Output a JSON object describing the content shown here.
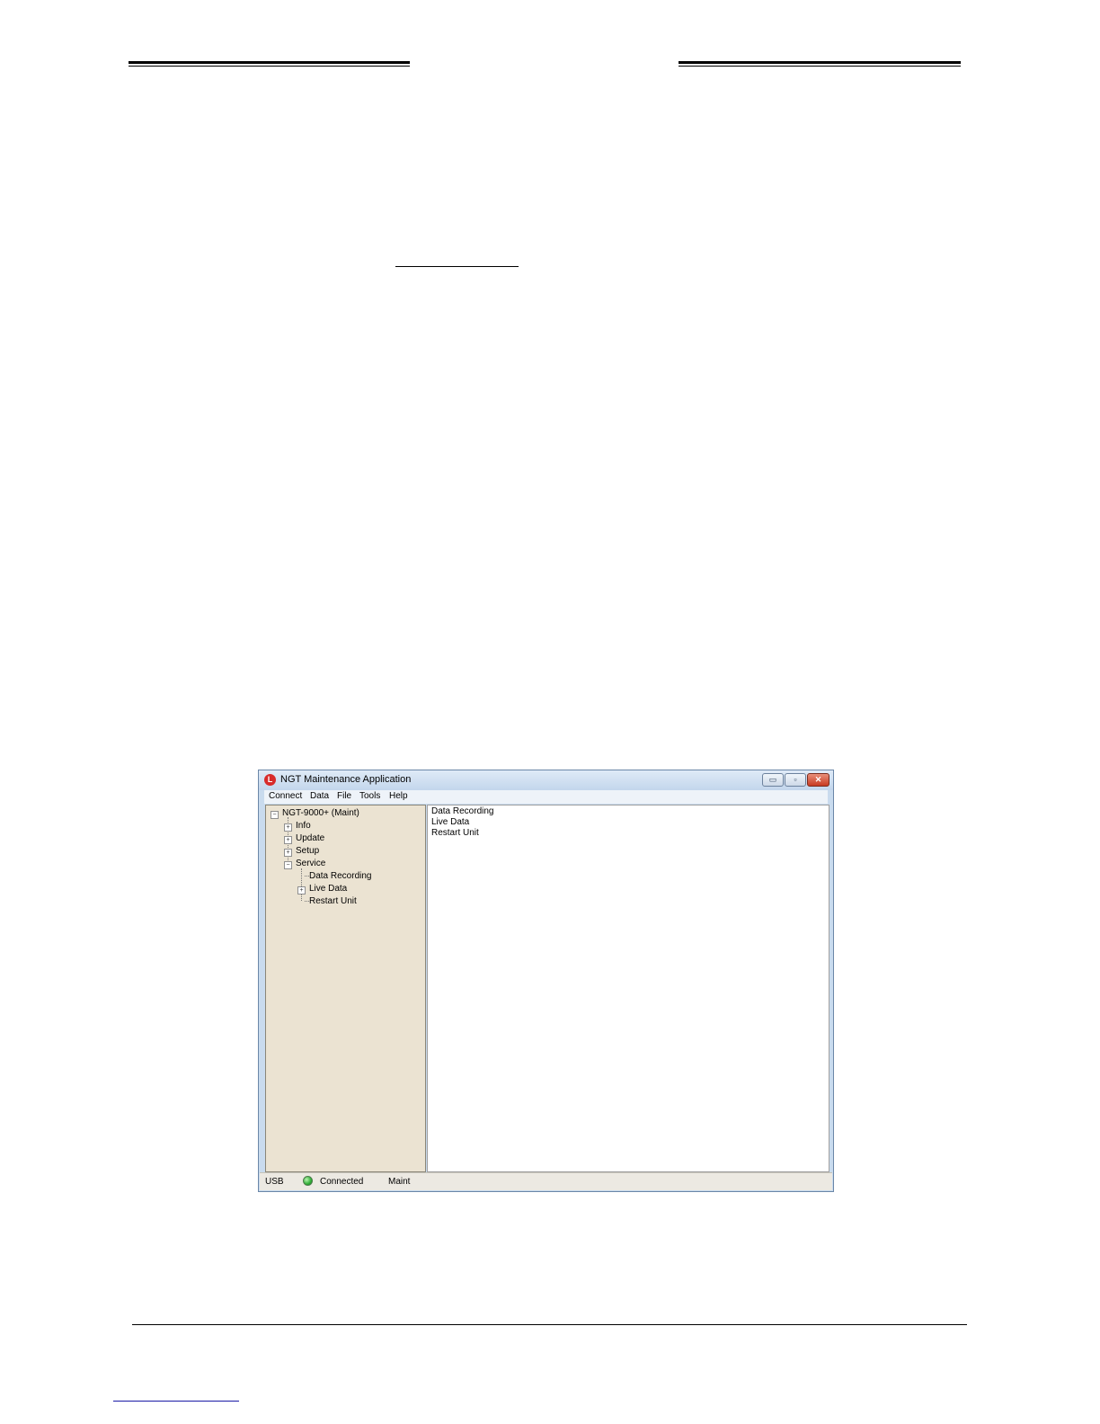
{
  "window": {
    "title": "NGT Maintenance Application",
    "controls": {
      "minimize": "▭",
      "maximize": "▫",
      "close": "✕"
    }
  },
  "menu": [
    "Connect",
    "Data",
    "File",
    "Tools",
    "Help"
  ],
  "tree": {
    "root": "NGT-9000+ (Maint)",
    "items": [
      "Info",
      "Update",
      "Setup",
      "Service"
    ],
    "service_children": [
      "Data Recording",
      "Live Data",
      "Restart Unit"
    ]
  },
  "content": {
    "items": [
      "Data Recording",
      "Live Data",
      "Restart Unit"
    ]
  },
  "status": {
    "port": "USB",
    "connection": "Connected",
    "mode": "Maint"
  },
  "colors": {
    "tree_background": "#ebe3d2",
    "status_led": "#2fae36",
    "close_button": "#c83a22"
  },
  "icons": [
    "app-logo-icon",
    "status-led-icon",
    "expand-plus-icon",
    "collapse-minus-icon"
  ]
}
